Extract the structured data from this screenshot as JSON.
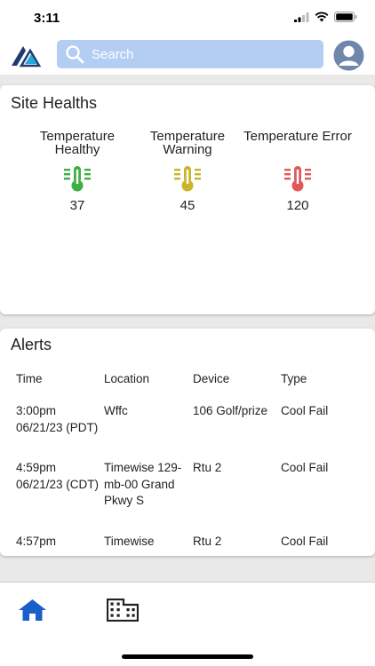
{
  "status_bar": {
    "time": "3:11"
  },
  "header": {
    "search_placeholder": "Search",
    "icons": [
      "app-logo-icon",
      "search-icon",
      "user-avatar-icon"
    ],
    "accent_color": "#b4cdf2"
  },
  "site_health": {
    "title": "Site Healths",
    "items": [
      {
        "label": "Temperature Healthy",
        "count": "37",
        "color": "#3cb043",
        "icon": "thermometer-icon"
      },
      {
        "label": "Temperature Warning",
        "count": "45",
        "color": "#c9b52b",
        "icon": "thermometer-icon"
      },
      {
        "label": "Temperature Error",
        "count": "120",
        "color": "#e2575a",
        "icon": "thermometer-icon"
      }
    ]
  },
  "alerts": {
    "title": "Alerts",
    "columns": [
      "Time",
      "Location",
      "Device",
      "Type"
    ],
    "rows": [
      [
        "3:00pm 06/21/23 (PDT)",
        "Wffc",
        "106 Golf/prize",
        "Cool Fail"
      ],
      [
        "4:59pm 06/21/23 (CDT)",
        "Timewise 129-mb-00 Grand Pkwy S",
        "Rtu 2",
        "Cool Fail"
      ],
      [
        "4:57pm",
        "Timewise",
        "Rtu 2",
        "Cool Fail"
      ]
    ]
  },
  "tab_bar": {
    "items": [
      {
        "name": "home",
        "icon": "home-icon",
        "color": "#1a5fc8"
      },
      {
        "name": "sites",
        "icon": "building-icon",
        "color": "#222222"
      }
    ]
  }
}
